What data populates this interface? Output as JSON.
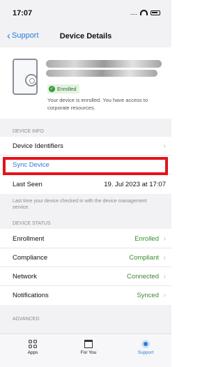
{
  "status": {
    "time": "17:07",
    "signal": "...."
  },
  "nav": {
    "back_label": "Support",
    "title": "Device Details"
  },
  "device": {
    "badge": "Enrolled",
    "description": "Your device is enrolled. You have access to corporate resources."
  },
  "sections": {
    "device_info": "DEVICE INFO",
    "device_status": "DEVICE STATUS",
    "advanced": "ADVANCED"
  },
  "info_rows": {
    "identifiers": "Device Identifiers",
    "sync": "Sync Device",
    "last_seen_label": "Last Seen",
    "last_seen_value": "19. Jul 2023 at 17:07"
  },
  "note": "Last time your device checked in with the device management service.",
  "status_rows": [
    {
      "label": "Enrollment",
      "value": "Enrolled"
    },
    {
      "label": "Compliance",
      "value": "Compliant"
    },
    {
      "label": "Network",
      "value": "Connected"
    },
    {
      "label": "Notifications",
      "value": "Synced"
    }
  ],
  "tabs": [
    {
      "label": "Apps",
      "icon": "apps-icon"
    },
    {
      "label": "For You",
      "icon": "for-you-icon"
    },
    {
      "label": "Support",
      "icon": "support-icon",
      "active": true
    }
  ],
  "colors": {
    "accent": "#2a7ad6",
    "status_green": "#3a8a2e",
    "highlight": "#e4131a"
  }
}
